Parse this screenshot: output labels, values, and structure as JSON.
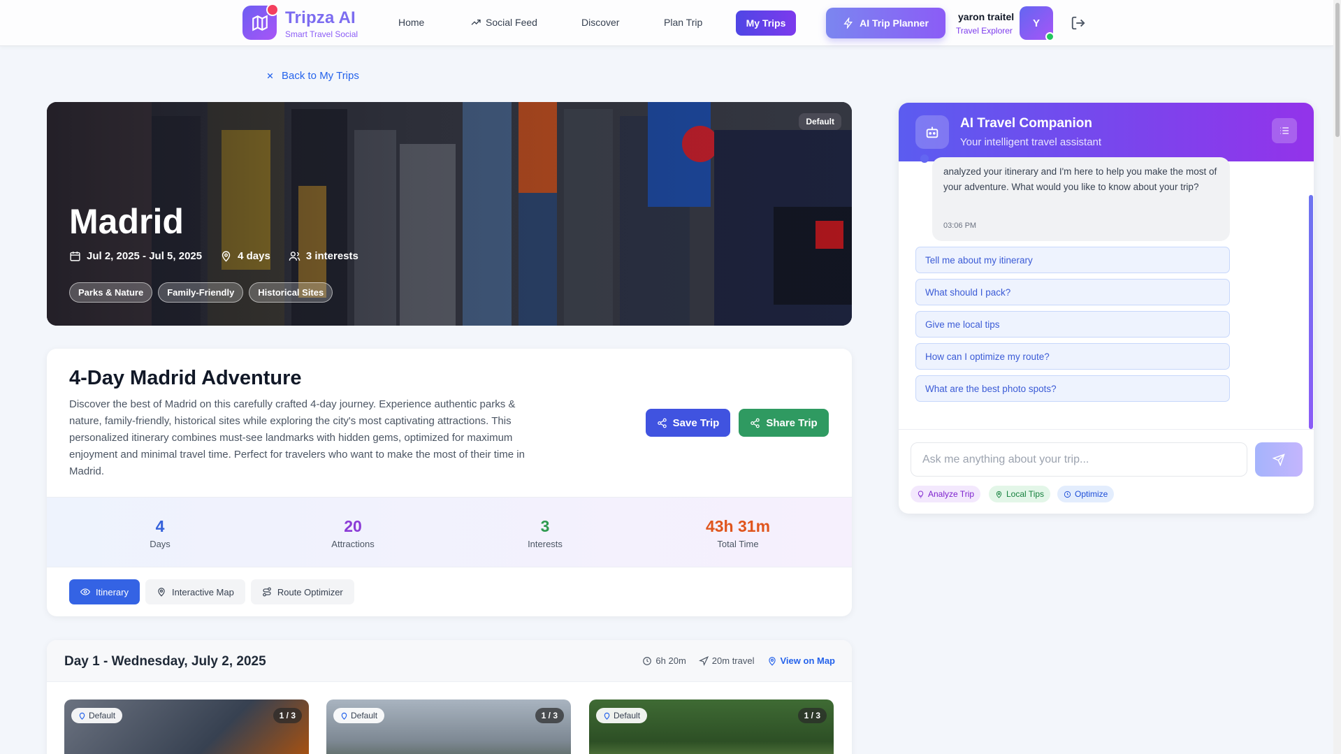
{
  "header": {
    "brand": "Tripza AI",
    "tagline": "Smart Travel Social",
    "nav": [
      "Home",
      "Social Feed",
      "Discover",
      "Plan Trip"
    ],
    "active_nav": "My Trips",
    "planner_button": "AI Trip Planner",
    "user_name": "yaron traitel",
    "user_role": "Travel Explorer",
    "avatar_initial": "Y"
  },
  "back_link": "Back to My Trips",
  "hero": {
    "badge": "Default",
    "city": "Madrid",
    "dates": "Jul 2, 2025 - Jul 5, 2025",
    "days": "4 days",
    "interests": "3 interests",
    "tags": [
      "Parks & Nature",
      "Family-Friendly",
      "Historical Sites"
    ]
  },
  "trip": {
    "title": "4-Day Madrid Adventure",
    "description": "Discover the best of Madrid on this carefully crafted 4-day journey. Experience authentic parks & nature, family-friendly, historical sites while exploring the city's most captivating attractions. This personalized itinerary combines must-see landmarks with hidden gems, optimized for maximum enjoyment and minimal travel time. Perfect for travelers who want to make the most of their time in Madrid.",
    "save_label": "Save Trip",
    "share_label": "Share Trip",
    "stats": [
      {
        "value": "4",
        "label": "Days",
        "color": "#3461db"
      },
      {
        "value": "20",
        "label": "Attractions",
        "color": "#8b3bd6"
      },
      {
        "value": "3",
        "label": "Interests",
        "color": "#2e9a4f"
      },
      {
        "value": "43h 31m",
        "label": "Total Time",
        "color": "#e0551d"
      }
    ],
    "tabs": [
      "Itinerary",
      "Interactive Map",
      "Route Optimizer"
    ]
  },
  "day1": {
    "title": "Day 1 - Wednesday, July 2, 2025",
    "duration": "6h 20m",
    "travel": "20m travel",
    "view_map": "View on Map",
    "attractions": [
      {
        "badge": "Default",
        "count": "1 / 3"
      },
      {
        "badge": "Default",
        "count": "1 / 3"
      },
      {
        "badge": "Default",
        "count": "1 / 3"
      }
    ]
  },
  "chat": {
    "title": "AI Travel Companion",
    "subtitle": "Your intelligent travel assistant",
    "message": "analyzed your itinerary and I'm here to help you make the most of your adventure. What would you like to know about your trip?",
    "time": "03:06 PM",
    "suggestions": [
      "Tell me about my itinerary",
      "What should I pack?",
      "Give me local tips",
      "How can I optimize my route?",
      "What are the best photo spots?"
    ],
    "input_placeholder": "Ask me anything about your trip...",
    "quick_actions": [
      "Analyze Trip",
      "Local Tips",
      "Optimize"
    ]
  }
}
